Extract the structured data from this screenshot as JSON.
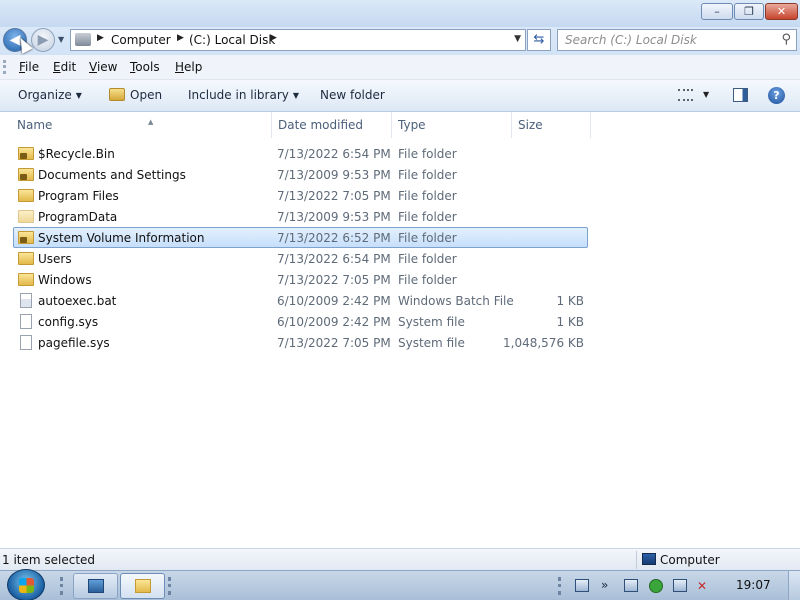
{
  "window": {
    "min_glyph": "–",
    "max_glyph": "❐",
    "close_glyph": "✕"
  },
  "nav": {
    "back_glyph": "◀",
    "forward_glyph": "▶",
    "address": [
      "Computer",
      "(C:) Local Disk"
    ],
    "search_placeholder": "Search (C:) Local Disk",
    "search_glyph": "⚲",
    "refresh_glyph": "⇆"
  },
  "menu": {
    "items": [
      {
        "label": "File",
        "underline": "F",
        "rest": "ile"
      },
      {
        "label": "Edit",
        "underline": "E",
        "rest": "dit"
      },
      {
        "label": "View",
        "underline": "V",
        "rest": "iew"
      },
      {
        "label": "Tools",
        "underline": "T",
        "rest": "ools"
      },
      {
        "label": "Help",
        "underline": "H",
        "rest": "elp"
      }
    ]
  },
  "toolbar": {
    "organize": "Organize",
    "open": "Open",
    "include": "Include in library",
    "new_folder": "New folder",
    "help_glyph": "?"
  },
  "columns": {
    "name": "Name",
    "date": "Date modified",
    "type": "Type",
    "size": "Size"
  },
  "files": [
    {
      "name": "$Recycle.Bin",
      "date": "7/13/2022 6:54 PM",
      "type": "File folder",
      "size": "",
      "icon": "folder-locked-icon"
    },
    {
      "name": "Documents and Settings",
      "date": "7/13/2009 9:53 PM",
      "type": "File folder",
      "size": "",
      "icon": "folder-locked-icon"
    },
    {
      "name": "Program Files",
      "date": "7/13/2022 7:05 PM",
      "type": "File folder",
      "size": "",
      "icon": "folder-icon"
    },
    {
      "name": "ProgramData",
      "date": "7/13/2009 9:53 PM",
      "type": "File folder",
      "size": "",
      "icon": "folder-faded-icon"
    },
    {
      "name": "System Volume Information",
      "date": "7/13/2022 6:52 PM",
      "type": "File folder",
      "size": "",
      "icon": "folder-locked-icon",
      "selected": true
    },
    {
      "name": "Users",
      "date": "7/13/2022 6:54 PM",
      "type": "File folder",
      "size": "",
      "icon": "folder-icon"
    },
    {
      "name": "Windows",
      "date": "7/13/2022 7:05 PM",
      "type": "File folder",
      "size": "",
      "icon": "folder-icon"
    },
    {
      "name": "autoexec.bat",
      "date": "6/10/2009 2:42 PM",
      "type": "Windows Batch File",
      "size": "1 KB",
      "icon": "batch-file-icon"
    },
    {
      "name": "config.sys",
      "date": "6/10/2009 2:42 PM",
      "type": "System file",
      "size": "1 KB",
      "icon": "file-icon"
    },
    {
      "name": "pagefile.sys",
      "date": "7/13/2022 7:05 PM",
      "type": "System file",
      "size": "1,048,576 KB",
      "icon": "file-icon"
    }
  ],
  "status": {
    "left": "1 item selected",
    "right": "Computer"
  },
  "taskbar": {
    "clock": "19:07",
    "chevron": "»"
  }
}
